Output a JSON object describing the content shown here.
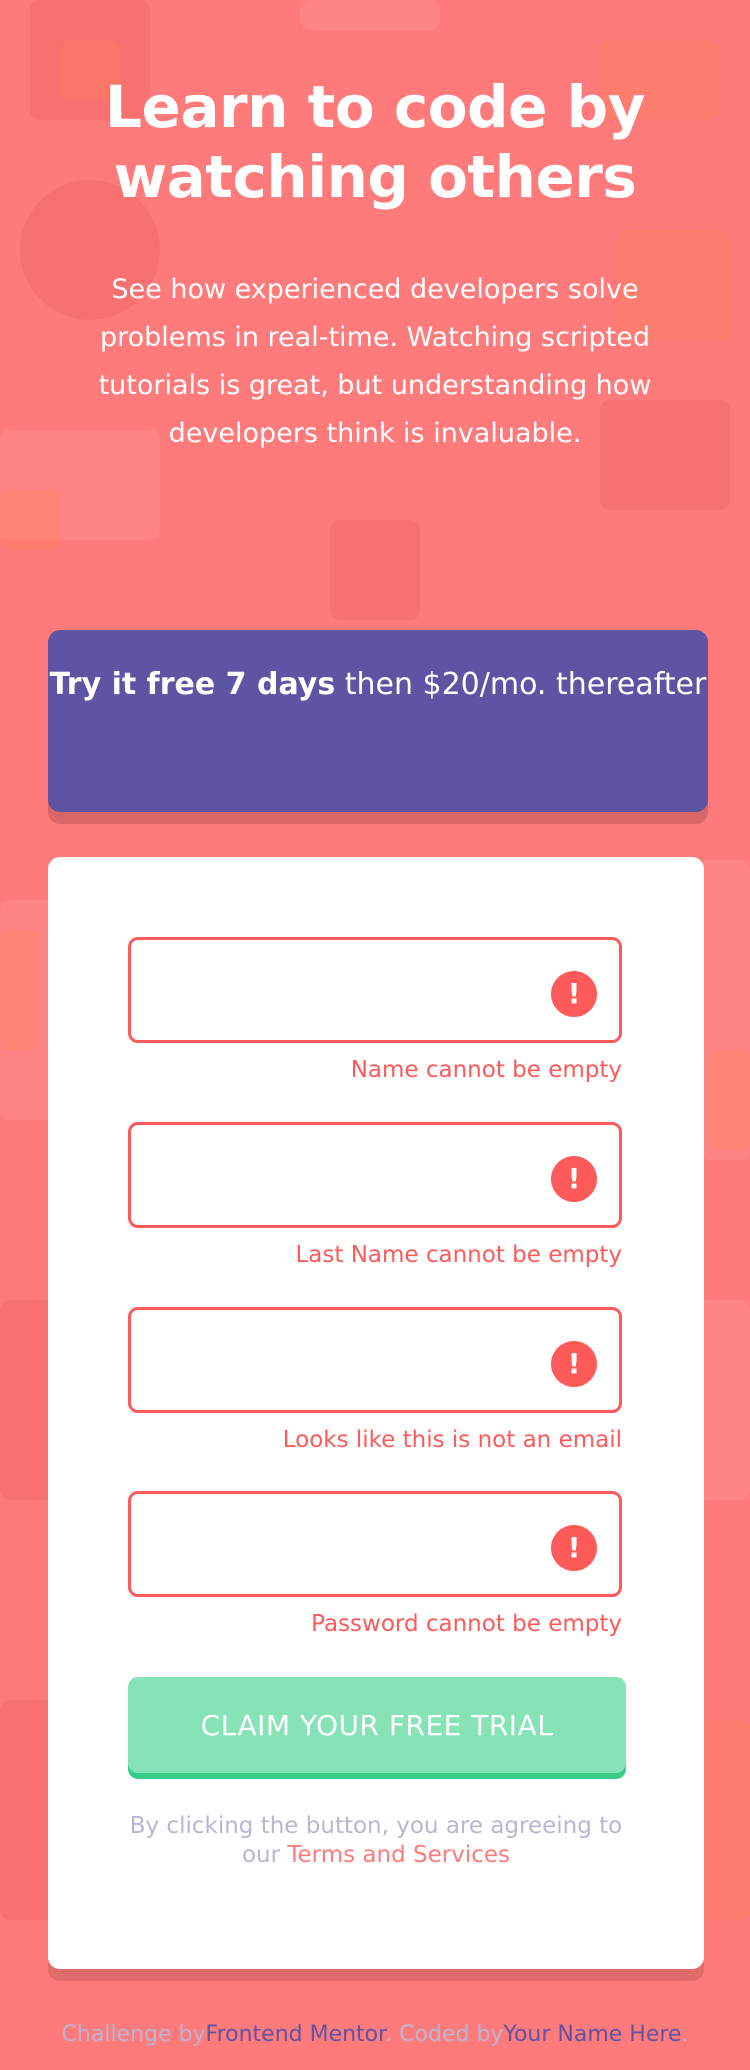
{
  "hero": {
    "title": "Learn to code by watching others",
    "description": "See how experienced developers solve problems in real-time. Watching scripted tutorials is great, but understanding how developers think is invaluable."
  },
  "offer": {
    "bold_text": "Try it free 7 days",
    "regular_text": " then $20/mo. thereafter"
  },
  "form": {
    "fields": [
      {
        "value": "",
        "placeholder": "",
        "error": "Name cannot be empty",
        "icon": "error-icon"
      },
      {
        "value": "",
        "placeholder": "",
        "error": "Last Name cannot be empty",
        "icon": "error-icon"
      },
      {
        "value": "",
        "placeholder": "",
        "error": "Looks like this is not an email",
        "icon": "error-icon"
      },
      {
        "value": "",
        "placeholder": "",
        "error": "Password cannot be empty",
        "icon": "error-icon"
      }
    ],
    "error_icon_glyph": "!",
    "submit_label": "CLAIM YOUR FREE TRIAL",
    "terms_prefix": "By clicking the button, you are agreeing to our ",
    "terms_link": "Terms and Services"
  },
  "footer": {
    "prefix": "Challenge by",
    "link1": "Frontend Mentor",
    "middle": ". Coded by",
    "link2": "Your Name Here",
    "suffix": "."
  },
  "colors": {
    "background": "#ff7a7a",
    "banner": "#5e54a4",
    "button": "#86e3b7",
    "button_shadow": "#38cc8b",
    "error": "#ff5a5a",
    "muted_text": "#b9b6d3"
  }
}
